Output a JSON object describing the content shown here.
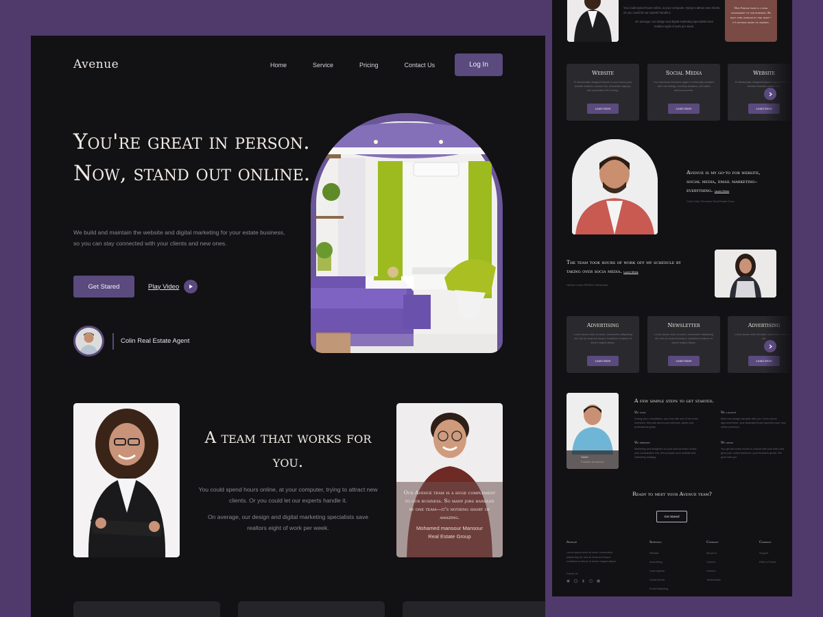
{
  "nav": {
    "logo": "Avenue",
    "links": [
      "Home",
      "Service",
      "Pricing",
      "Contact Us"
    ],
    "login": "Log In"
  },
  "hero": {
    "title": "You're great in person. Now, stand out online.",
    "subtitle": "We build and maintain the website and digital marketing for your estate business, so you can stay connected with your clients and new ones.",
    "cta": "Get Stared",
    "play": "Play Video",
    "agent_label": "Colin Real Estate Agent"
  },
  "team": {
    "title": "A team that works for you.",
    "p1": "You could spend hours online, at your computer, trying to attract new clients. Or you could let our experts handle it.",
    "p2": "On average, our design and digital marketing specialists save realtors eight of work per week.",
    "quote": "Our Avenue team is a huge complement to our business. So many jobs handled by one team—it's nothing short of amazing.",
    "quote_name": "Mohamed mansour Mansour",
    "quote_role": "Real Estate Group"
  },
  "preview": {
    "top_text1": "You could spend hours online, at your computer, trying to attract new clients. Or you could let our experts handle it.",
    "top_text2": "On average, our design and digital marketing specialists save realtors eight of work per week.",
    "top_quote": "Our Avenue team is a huge complement to our business. So many jobs handled by one team—it's nothing short of amazing.",
    "services_1": [
      {
        "title": "Website",
        "desc": "Professionally designed based on your brand your website features contact info, newsletter signups, and syndicates MLS listing.",
        "btn": "Learn More"
      },
      {
        "title": "Social Media",
        "desc": "Your facebook Business page is continually updated with new listings, monthly statistics, and sales announcements.",
        "btn": "Learn More"
      },
      {
        "title": "Website",
        "desc": "Professionally designed based on your brand your website features contact info.",
        "btn": "Learn More"
      }
    ],
    "testimonial_1": {
      "quote": "Avenue is my go-to for website, social media, email marketing– everything.",
      "link": "Learn More",
      "caption": "Colin Colin Princeton Real Estate Grou..."
    },
    "testimonial_2": {
      "quote": "The team took hours of work off my schedule by taking over socia media.",
      "link": "Learn More",
      "caption": "Harlow Locke RE/MAX Westcoast"
    },
    "services_2": [
      {
        "title": "Advertising",
        "desc": "Lorem ipsum dolor sit amet, consectetur adipiscing elit, sed do eiusmod tempor incididunt ut labore et dolore magna aliqua.",
        "btn": "Learn More"
      },
      {
        "title": "Newsletter",
        "desc": "Lorem ipsum dolor sit amet, consectetur adipiscing elit, sed do eiusmod tempor incididunt ut labore et dolore magna aliqua.",
        "btn": "Learn More"
      },
      {
        "title": "Advertising",
        "desc": "Lorem ipsum dolor sit amet, consectetur adipiscing elit.",
        "btn": "Learn More"
      }
    ],
    "steps_title": "A few simple steps to get started.",
    "steps": [
      {
        "h": "We chat",
        "t": "During your consultation, you chat with one of our team members, they ask about your interests, tastes and professional goals."
      },
      {
        "h": "We launch",
        "t": "Most new design samples with you. Once you've approved them, your dedicated team launches your new online presence."
      },
      {
        "h": "We prepare",
        "t": "Marketing and designers on your Avenue team review your consultation info, then prepare your website and marketing strategy."
      },
      {
        "h": "We grow",
        "t": "You get two every month to consult with your team and grow your online presence, your business grows. We grow with you."
      }
    ],
    "step_person_name": "Sarah",
    "step_person_role": "Founder of Avenue",
    "ready": "Ready to meet your Avenue team?",
    "ready_btn": "Get Stared",
    "footer": {
      "brand": "Avenue",
      "brand_text": "Lorem ipsum dolor sit amet, consectetur adipiscing elit, sed do eiusmod tempor incididunt ut labore et dolore magna aliqua.",
      "follow": "Follow Us",
      "col1_title": "Services",
      "col1": [
        "Website",
        "Advertising",
        "Lead capture",
        "Social Media",
        "Email Marketing"
      ],
      "col2_title": "Company",
      "col2": [
        "About us",
        "Careers",
        "Careers",
        "Testimonials"
      ],
      "col3_title": "Company",
      "col3": [
        "Support",
        "Refer a Friend"
      ]
    }
  },
  "colors": {
    "accent": "#5a4a7e",
    "background": "#121114",
    "page": "#4f3a6b"
  }
}
